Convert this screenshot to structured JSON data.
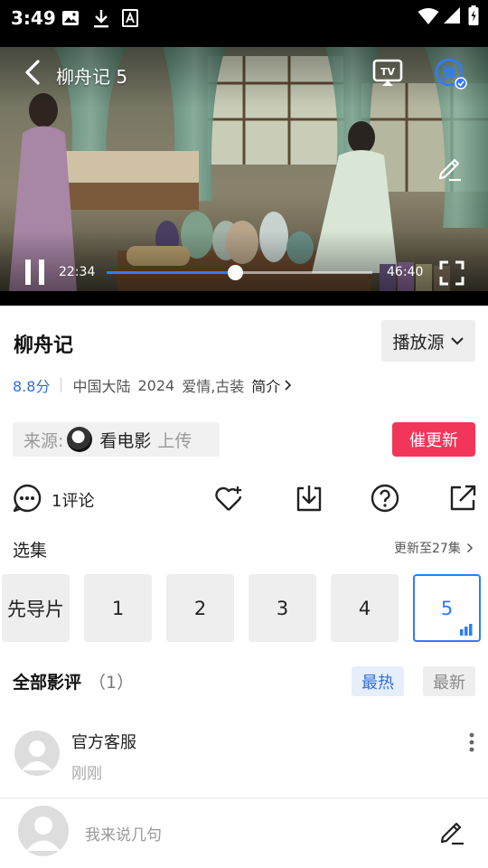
{
  "status_bar": {
    "time": "3:49"
  },
  "player": {
    "episode_title": "柳舟记 5",
    "current_time": "22:34",
    "duration": "46:40",
    "progress_fraction": 0.484,
    "icons": [
      "back-arrow-icon",
      "tv-cast-icon",
      "danmaku-icon",
      "edit-pen-icon",
      "pause-icon",
      "fullscreen-icon"
    ],
    "accent_color": "#2f7bff"
  },
  "info": {
    "title": "柳舟记",
    "source_button": "播放源",
    "score": "8.8分",
    "region": "中国大陆",
    "year": "2024",
    "genres": "爱情,古装",
    "intro_link": "简介"
  },
  "uploader": {
    "label": "来源:",
    "name": "看电影",
    "action": "上传"
  },
  "urge_button": "催更新",
  "actions": {
    "comment_count": "1评论",
    "icons": [
      "comment-icon",
      "favorite-add-icon",
      "download-icon",
      "help-icon",
      "share-icon"
    ]
  },
  "episodes_section": {
    "title": "选集",
    "update_info": "更新至27集",
    "items": [
      {
        "label": "先导片",
        "active": false
      },
      {
        "label": "1",
        "active": false
      },
      {
        "label": "2",
        "active": false
      },
      {
        "label": "3",
        "active": false
      },
      {
        "label": "4",
        "active": false
      },
      {
        "label": "5",
        "active": true
      }
    ]
  },
  "reviews": {
    "title": "全部影评",
    "count": "（1）",
    "sort_hot": "最热",
    "sort_new": "最新",
    "items": [
      {
        "author": "官方客服",
        "time": "刚刚"
      }
    ]
  },
  "composer": {
    "placeholder": "我来说几句"
  },
  "colors": {
    "urge": "#f2365a",
    "score": "#2f6fd6",
    "active_episode": "#2f7bff"
  }
}
